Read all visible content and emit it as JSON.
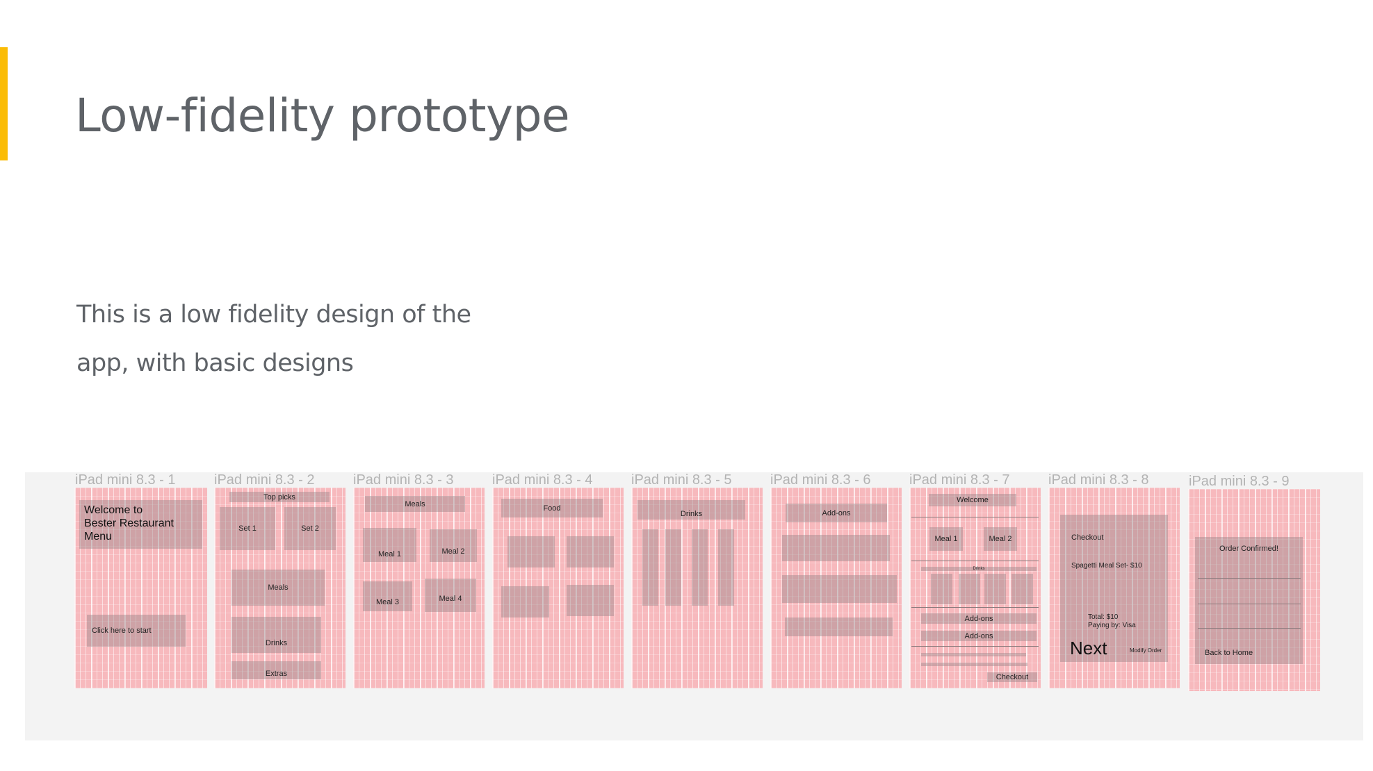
{
  "slide": {
    "title": "Low-fidelity prototype",
    "description_lines": [
      "This is a low fidelity design of the",
      "app, with basic designs"
    ],
    "accent_color": "#fbbc05"
  },
  "frames": [
    {
      "label": "iPad mini 8.3 - 1",
      "texts": {
        "welcome": "Welcome to\nBester Restaurant\nMenu",
        "start": "Click here to start"
      }
    },
    {
      "label": "iPad mini 8.3 - 2",
      "texts": {
        "top_picks": "Top picks",
        "set1": "Set 1",
        "set2": "Set 2",
        "meals": "Meals",
        "drinks": "Drinks",
        "extras": "Extras"
      }
    },
    {
      "label": "iPad mini 8.3 - 3",
      "texts": {
        "meals": "Meals",
        "meal1": "Meal 1",
        "meal2": "Meal 2",
        "meal3": "Meal 3",
        "meal4": "Meal 4"
      }
    },
    {
      "label": "iPad mini 8.3 - 4",
      "texts": {
        "food": "Food"
      }
    },
    {
      "label": "iPad mini 8.3 - 5",
      "texts": {
        "drinks": "Drinks"
      }
    },
    {
      "label": "iPad mini 8.3 - 6",
      "texts": {
        "addons": "Add-ons"
      }
    },
    {
      "label": "iPad mini 8.3 - 7",
      "texts": {
        "welcome": "Welcome",
        "meal1": "Meal 1",
        "meal2": "Meal 2",
        "drinks": "Drinks",
        "addons1": "Add-ons",
        "addons2": "Add-ons",
        "checkout": "Checkout"
      }
    },
    {
      "label": "iPad mini 8.3 - 8",
      "texts": {
        "checkout": "Checkout",
        "item": "Spagetti Meal Set- $10",
        "total": "Total: $10",
        "paying": "Paying by: Visa",
        "next": "Next",
        "modify": "Modify Order"
      }
    },
    {
      "label": "iPad mini 8.3 - 9",
      "texts": {
        "confirmed": "Order Confirmed!",
        "back": "Back to Home"
      }
    }
  ]
}
